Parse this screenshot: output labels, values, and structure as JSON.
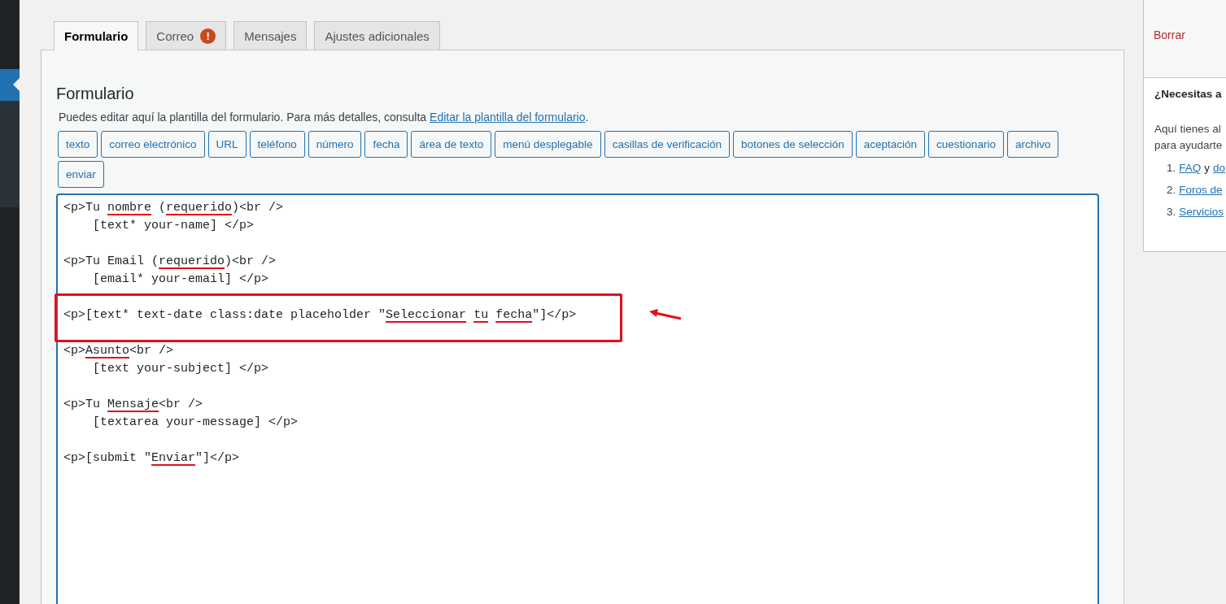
{
  "tabs": [
    {
      "label": "Formulario",
      "selected": true,
      "alert": false
    },
    {
      "label": "Correo",
      "selected": false,
      "alert": true,
      "alert_text": "!"
    },
    {
      "label": "Mensajes",
      "selected": false,
      "alert": false
    },
    {
      "label": "Ajustes adicionales",
      "selected": false,
      "alert": false
    }
  ],
  "panel": {
    "title": "Formulario",
    "description": "Puedes editar aquí la plantilla del formulario. Para más detalles, consulta ",
    "link": "Editar la plantilla del formulario",
    "description_end": ".",
    "tag_buttons": [
      "texto",
      "correo electrónico",
      "URL",
      "teléfono",
      "número",
      "fecha",
      "área de texto",
      "menú desplegable",
      "casillas de verificación",
      "botones de selección",
      "aceptación",
      "cuestionario",
      "archivo",
      "enviar"
    ],
    "editor_blocks": [
      [
        [
          {
            "text": "<p>Tu",
            "misspelled": false
          },
          {
            "text": "nombre",
            "misspelled": true
          },
          {
            "text": "(",
            "misspelled": false
          },
          {
            "text": "requerido",
            "misspelled": true
          },
          {
            "text": ")<br />",
            "misspelled": false
          }
        ],
        [
          {
            "text": "[text* your-name] </p>",
            "misspelled": false
          }
        ]
      ],
      [
        [
          {
            "text": "<p>Tu Email (",
            "misspelled": false
          },
          {
            "text": "requerido",
            "misspelled": true
          },
          {
            "text": ")<br />",
            "misspelled": false
          }
        ],
        [
          {
            "text": "[email* your-email] </p>",
            "misspelled": false
          }
        ]
      ],
      [
        [
          {
            "text": "<p>[text* text-date class:date placeholder \"",
            "misspelled": false
          },
          {
            "text": "Seleccionar tu fecha",
            "misspelled": true
          },
          {
            "text": "\"]</p>",
            "misspelled": false
          }
        ]
      ],
      [
        [
          {
            "text": "<p>",
            "misspelled": false
          },
          {
            "text": "Asunto",
            "misspelled": true
          },
          {
            "text": "<br />",
            "misspelled": false
          }
        ],
        [
          {
            "text": "[text your-subject] </p>",
            "misspelled": false
          }
        ]
      ],
      [
        [
          {
            "text": "<p>Tu",
            "misspelled": false
          },
          {
            "text": "Mensaje",
            "misspelled": true
          },
          {
            "text": "<br />",
            "misspelled": false
          }
        ],
        [
          {
            "text": "[textarea your-message] </p>",
            "misspelled": false
          }
        ]
      ],
      [
        [
          {
            "text": "<p>[submit \"",
            "misspelled": false
          },
          {
            "text": "Enviar",
            "misspelled": true
          },
          {
            "text": "\"]</p>",
            "misspelled": false
          }
        ]
      ]
    ]
  },
  "sidebar": {
    "delete_link": "Borrar",
    "help_title": "¿Necesitas a",
    "help_text_lines": [
      "Aquí tienes al",
      "para ayudarte"
    ],
    "help_items": [
      {
        "number": "1.",
        "parts": [
          {
            "text": "FAQ",
            "link": true
          },
          {
            "text": "y",
            "link": false
          },
          {
            "text": "do",
            "link": true
          }
        ]
      },
      {
        "number": "2.",
        "parts": [
          {
            "text": "Foros de",
            "link": true
          }
        ]
      },
      {
        "number": "3.",
        "parts": [
          {
            "text": "Servicios",
            "link": true
          }
        ]
      }
    ]
  }
}
